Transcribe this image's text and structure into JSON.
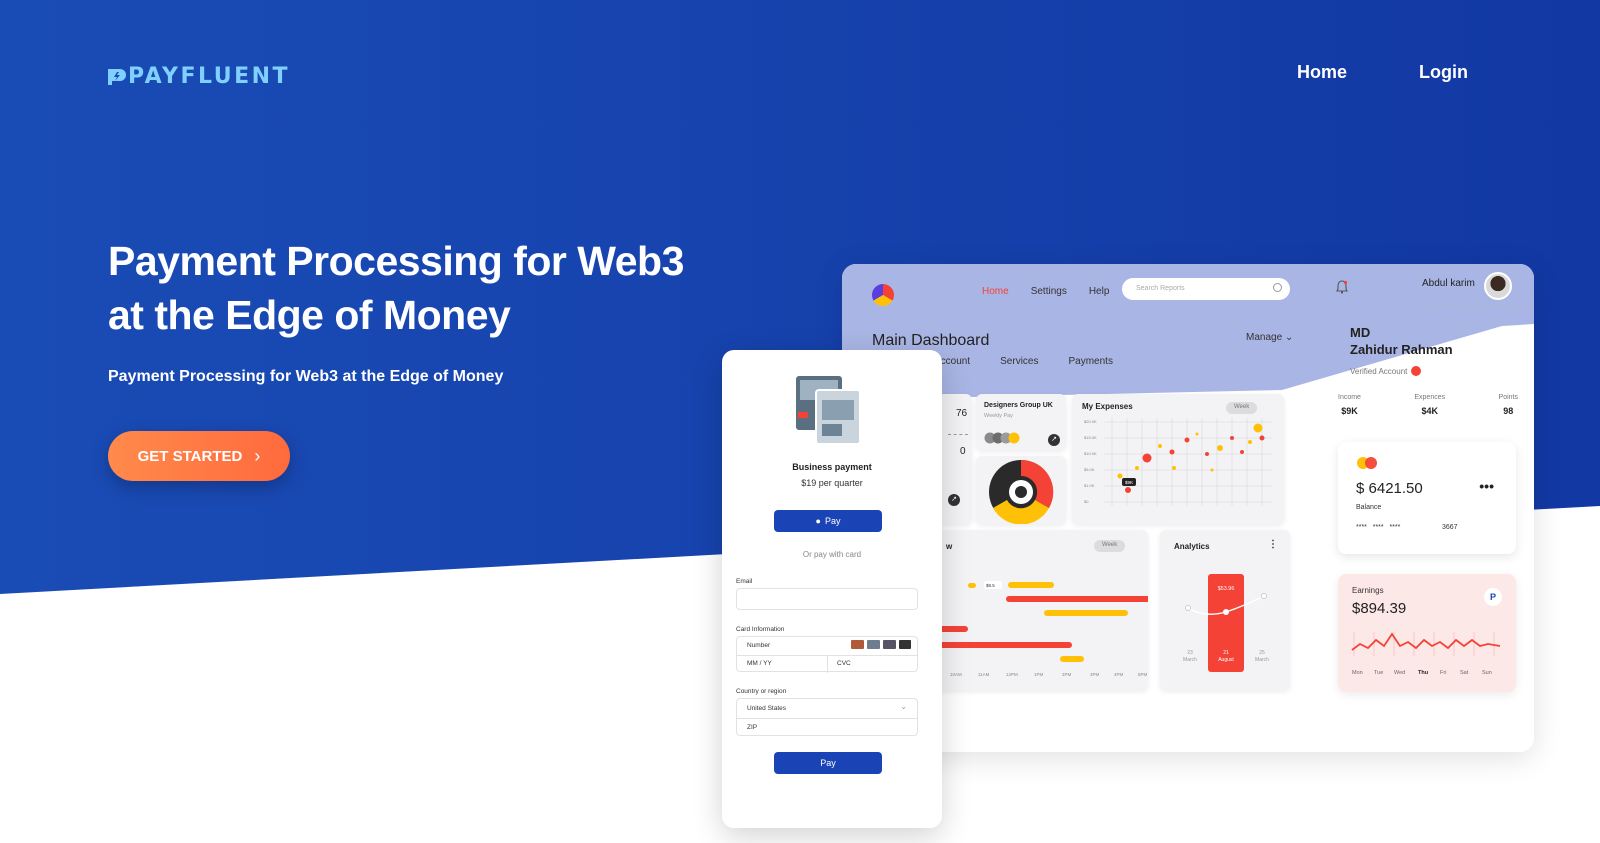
{
  "brand": {
    "name": "PAYFLUENT"
  },
  "nav": {
    "home": "Home",
    "login": "Login"
  },
  "hero": {
    "headline_line1": "Payment Processing for Web3",
    "headline_line2": "at the Edge of Money",
    "subheadline": "Payment Processing for Web3 at the Edge of Money",
    "cta_label": "GET STARTED"
  },
  "colors": {
    "hero_blue": "#1d4fb8",
    "cta_orange": "#ff7a45",
    "accent_red": "#f44336",
    "accent_yellow": "#ffc107"
  },
  "dashboard": {
    "nav": [
      "Home",
      "Settings",
      "Help"
    ],
    "search_placeholder": "Search Reports",
    "user_name": "Abdul karim",
    "title": "Main Dashboard",
    "tabs": [
      "Account",
      "Services",
      "Payments"
    ],
    "manage": "Manage",
    "stat_partial_1": "76",
    "stat_partial_2": "0",
    "designers": {
      "title": "Designers Group UK",
      "subtitle": "Weekly Pay"
    },
    "expenses": {
      "title": "My Expenses",
      "period": "Week",
      "y_ticks": [
        "$20.0K",
        "$15.0K",
        "$10.0K",
        "$5.0K",
        "$1.0K",
        "$0"
      ],
      "tag": "$9K"
    },
    "overview": {
      "title_partial": "w",
      "period": "Week",
      "tag": "$8.5",
      "x_ticks": [
        "10AM",
        "11AM",
        "12PM",
        "1PM",
        "2PM",
        "3PM",
        "4PM",
        "5PM"
      ]
    },
    "analytics": {
      "title": "Analytics",
      "value": "$53.96",
      "left_day": "23",
      "left_month": "March",
      "mid_day": "21",
      "mid_month": "August",
      "right_day": "25",
      "right_month": "March"
    },
    "profile": {
      "line1": "MD",
      "line2": "Zahidur Rahman",
      "verified": "Verified Account",
      "income_label": "Income",
      "income": "$9K",
      "expences_label": "Expences",
      "expences": "$4K",
      "points_label": "Points",
      "points": "98"
    },
    "balance": {
      "amount": "$ 6421.50",
      "label": "Balance",
      "masked": "****   ****   ****",
      "last4": "3667"
    },
    "earnings": {
      "label": "Earnings",
      "amount": "$894.39",
      "days": [
        "Mon",
        "Tue",
        "Wed",
        "Thu",
        "Fri",
        "Sat",
        "Sun"
      ]
    }
  },
  "checkout": {
    "title": "Business payment",
    "price": "$19 per quarter",
    "wallet_pay": "Pay",
    "or_text": "Or pay with card",
    "email_label": "Email",
    "card_label": "Card Information",
    "number_placeholder": "Number",
    "expiry_placeholder": "MM / YY",
    "cvc_placeholder": "CVC",
    "country_label": "Country or region",
    "country_value": "United States",
    "zip_placeholder": "ZIP",
    "submit": "Pay"
  }
}
